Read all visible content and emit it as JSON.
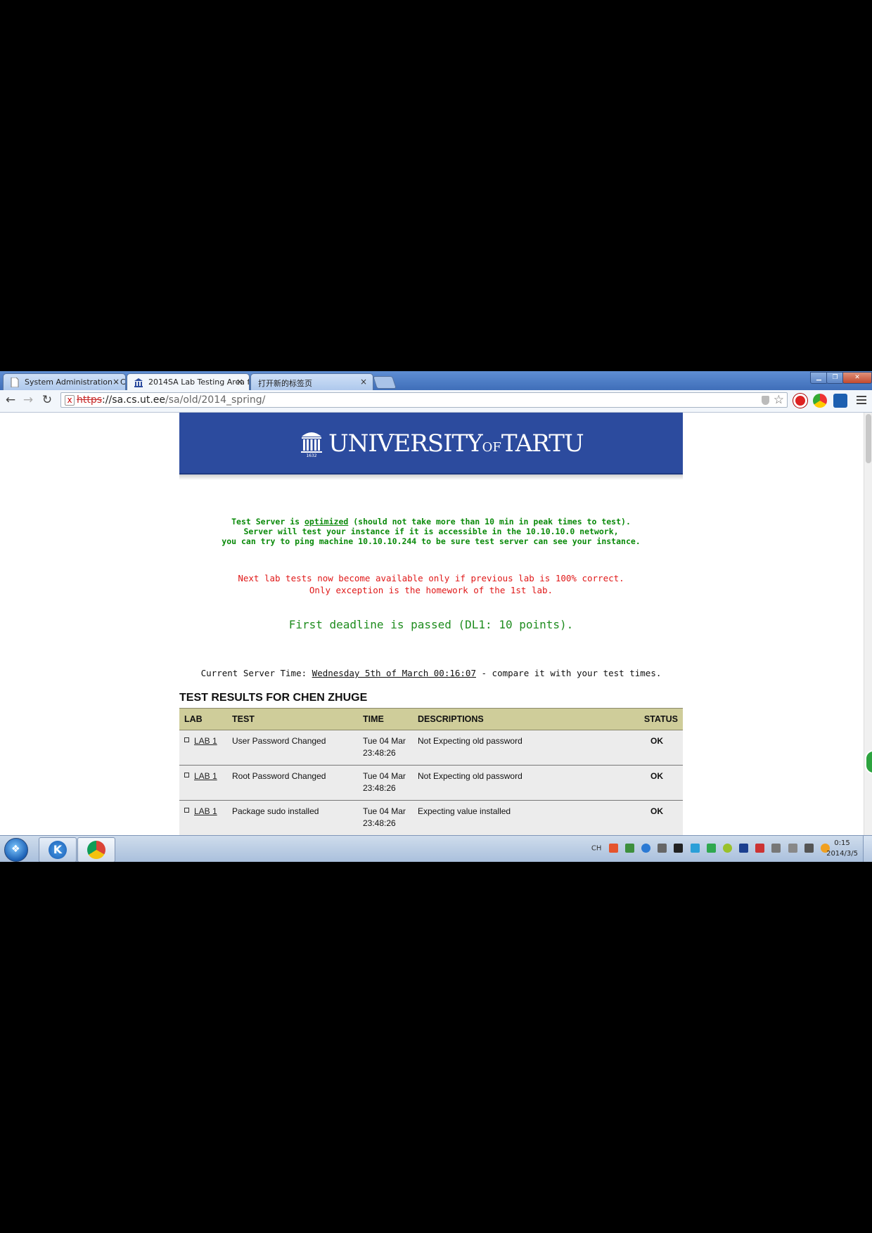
{
  "browser": {
    "tabs": [
      {
        "label": "System Administration - C",
        "active": false
      },
      {
        "label": "2014SA Lab Testing Area f",
        "active": true
      },
      {
        "label": "打开新的标签页",
        "active": false
      }
    ],
    "url": {
      "scheme": "https",
      "host": "://sa.cs.ut.ee",
      "path": "/sa/old/2014_spring/"
    },
    "icons": [
      "back-icon",
      "forward-icon",
      "reload-icon",
      "shield-icon",
      "star-icon",
      "menu-icon"
    ]
  },
  "page": {
    "logo": {
      "text_main": "UNIVERSITY",
      "text_of": "OF",
      "text_end": "TARTU",
      "year": "1632"
    },
    "notice": {
      "line1_pre": "Test Server is ",
      "line1_link": "optimized",
      "line1_post": " (should not take more than 10 min in peak times to test).",
      "line2": "Server will test your instance if it is accessible in the 10.10.10.0 network,",
      "line3": "you can try to ping machine 10.10.10.244 to be sure test server can see your instance."
    },
    "rule": {
      "line1": "Next lab tests now become available only if previous lab is 100% correct.",
      "line2": "Only exception is the homework of the 1st lab."
    },
    "deadline": "First deadline is passed (DL1: 10 points).",
    "server_time": {
      "label": "Current Server Time: ",
      "value": "Wednesday 5th of March 00:16:07",
      "suffix": " - compare it with your test times."
    },
    "results_title": "TEST RESULTS FOR CHEN ZHUGE",
    "table": {
      "headers": [
        "LAB",
        "TEST",
        "TIME",
        "DESCRIPTIONS",
        "STATUS"
      ],
      "rows": [
        {
          "lab": "LAB 1",
          "test": "User Password Changed",
          "time1": "Tue 04 Mar",
          "time2": "23:48:26",
          "desc": "Not Expecting old password",
          "status": "OK"
        },
        {
          "lab": "LAB 1",
          "test": "Root Password Changed",
          "time1": "Tue 04 Mar",
          "time2": "23:48:26",
          "desc": "Not Expecting old password",
          "status": "OK"
        },
        {
          "lab": "LAB 1",
          "test": "Package sudo installed",
          "time1": "Tue 04 Mar",
          "time2": "23:48:26",
          "desc": "Expecting value installed",
          "status": "OK"
        }
      ]
    }
  },
  "taskbar": {
    "lang": "CH",
    "clock_time": "0:15",
    "clock_date": "2014/3/5"
  },
  "colors": {
    "banner": "#2c4b9e",
    "notice_green": "#0a8a0a",
    "rule_red": "#e01818",
    "table_header": "#cfcd9a",
    "row_bg": "#ececec"
  }
}
